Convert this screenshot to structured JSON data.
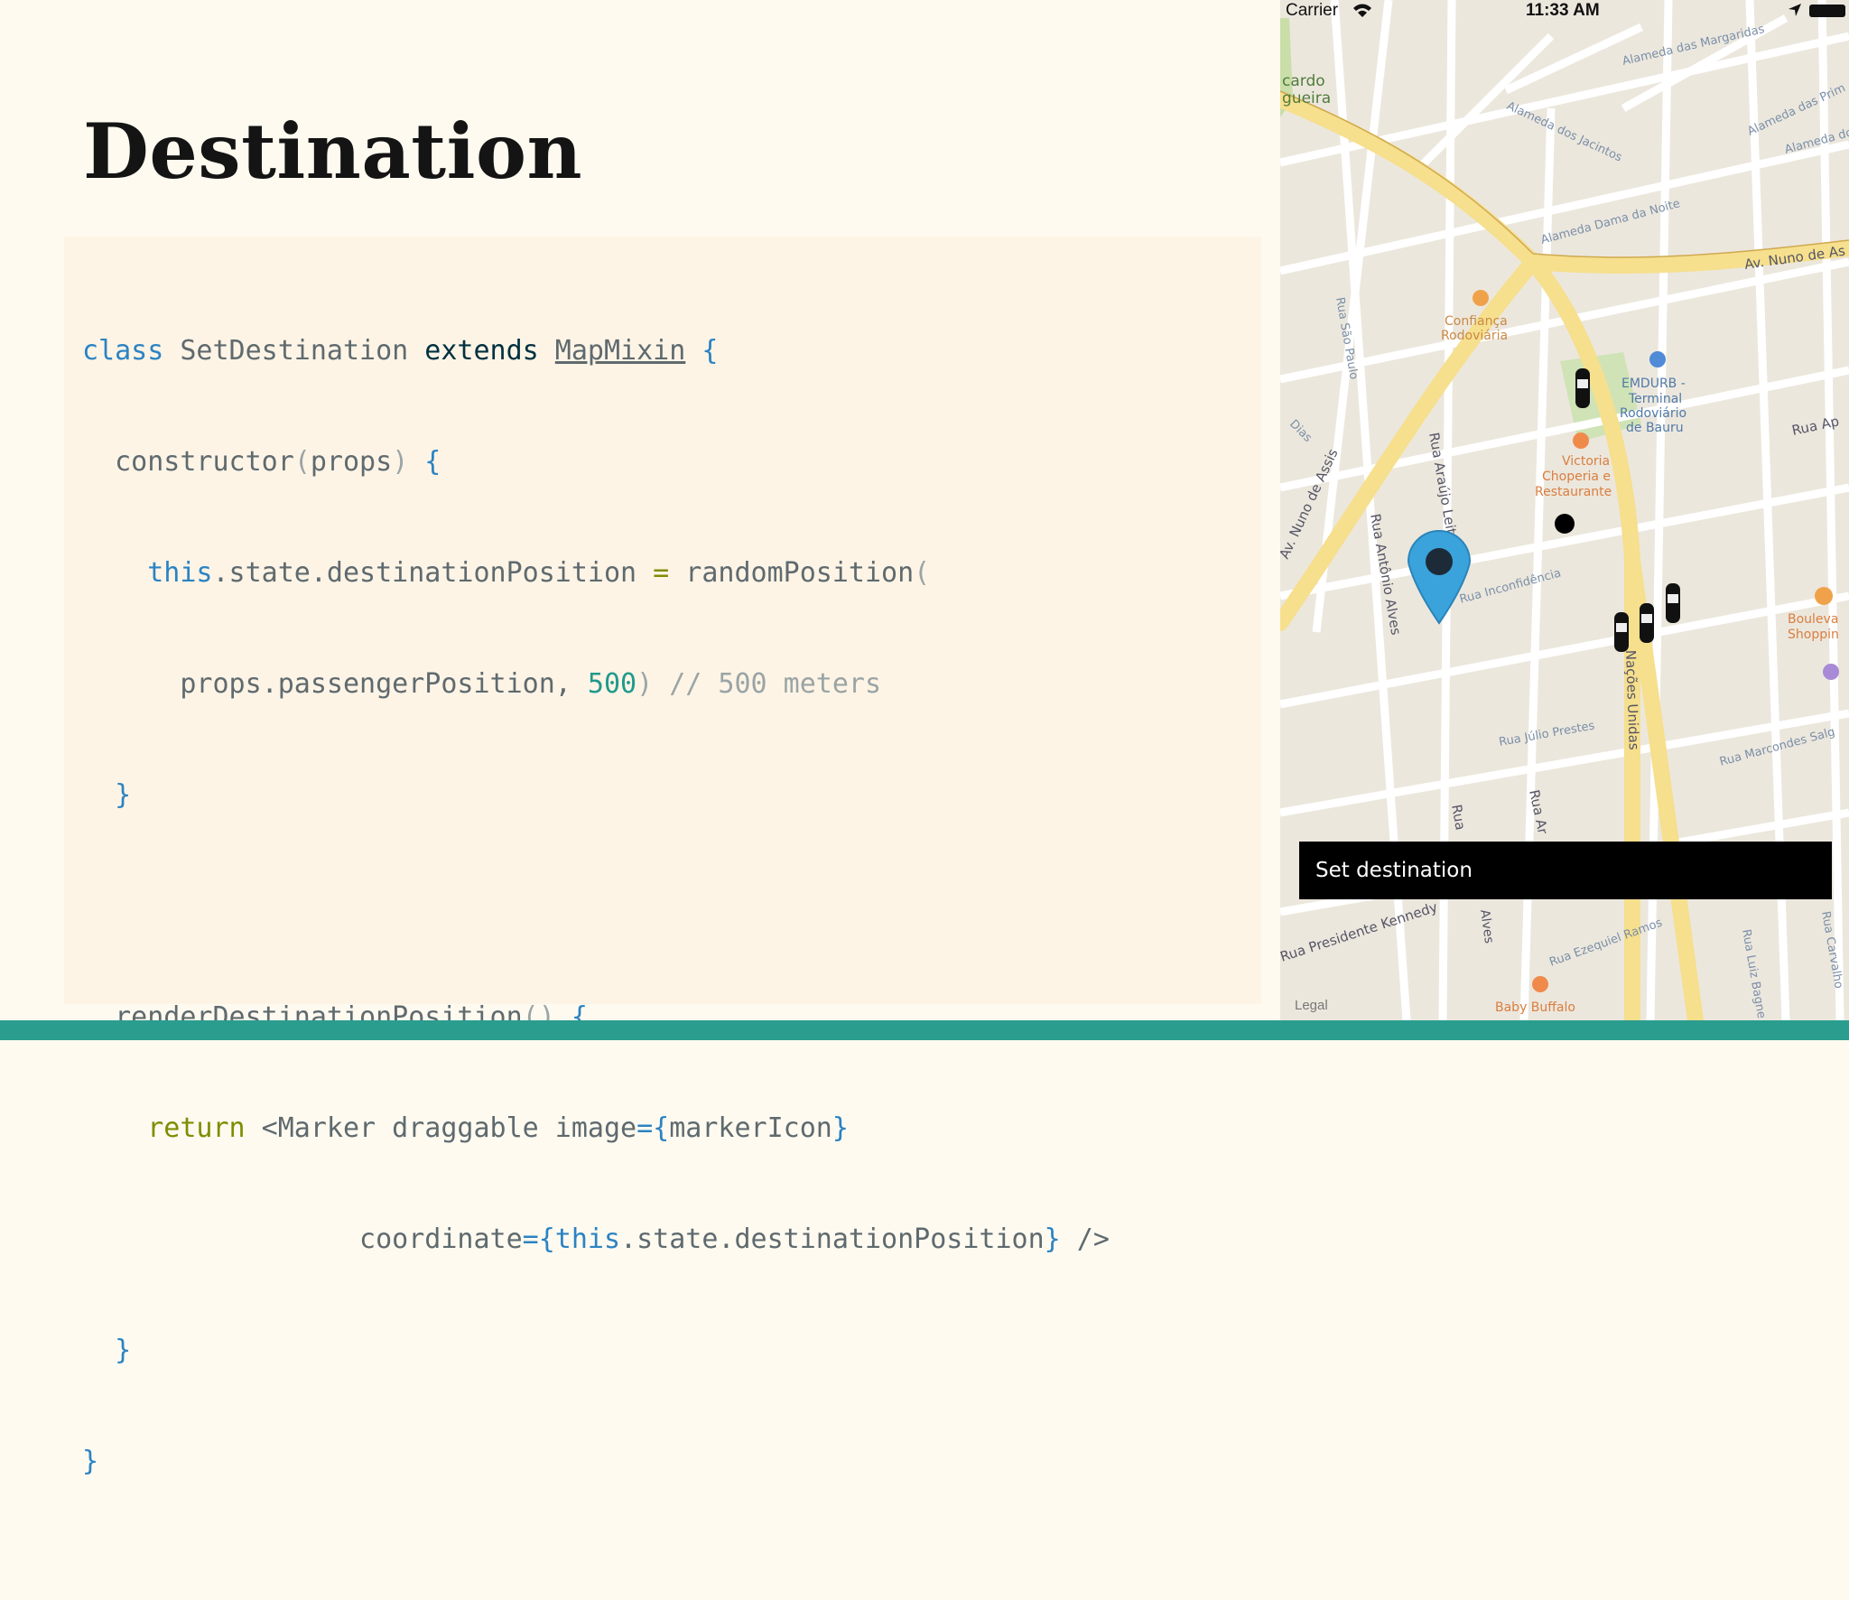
{
  "slide": {
    "title": "Destination",
    "code": {
      "l1": {
        "kw": "class",
        "name": " SetDestination ",
        "ext": "extends",
        "sp": " ",
        "base": "MapMixin",
        "brace": " {"
      },
      "l2": {
        "indent": "  ",
        "fn": "constructor",
        "p1": "(",
        "arg": "props",
        "p2": ")",
        "brace": " {"
      },
      "l3": {
        "indent": "    ",
        "this": "this",
        "rest": ".state.destinationPosition ",
        "op": "=",
        "call": " randomPosition",
        "paren": "("
      },
      "l4": {
        "indent": "      ",
        "arg": "props.passengerPosition, ",
        "num": "500",
        "paren": ")",
        "comment": " // 500 meters"
      },
      "l5": {
        "indent": "  ",
        "brace": "}"
      },
      "l7": {
        "indent": "  ",
        "fn": "renderDestinationPosition",
        "parens": "()",
        "brace": " {"
      },
      "l8": {
        "indent": "    ",
        "ret": "return",
        "tag": " <Marker draggable image",
        "eq": "={",
        "val": "markerIcon",
        "close": "}"
      },
      "l9": {
        "indent": "                 ",
        "attr": "coordinate",
        "eq": "={",
        "this": "this",
        "val": ".state.destinationPosition",
        "close": "}",
        "end": " />"
      },
      "l10": {
        "indent": "  ",
        "brace": "}"
      },
      "l11": {
        "brace": "}"
      }
    }
  },
  "phone": {
    "carrier": "Carrier",
    "time": "11:33 AM",
    "action_bar_label": "Set destination",
    "legal": "Legal",
    "map_labels": {
      "cardo": "cardo",
      "gueira": "gueira",
      "alameda_margaridas": "Alameda das Margaridas",
      "alameda_jacintos": "Alameda dos Jacintos",
      "alameda_prim": "Alameda das Prim",
      "alameda_do": "Alameda do",
      "alameda_dama": "Alameda Dama da Noite",
      "av_nuno": "Av. Nuno de As",
      "confianca": "Confiança",
      "rodoviaria": "Rodoviária",
      "emdurb1": "EMDURB -",
      "emdurb2": "Terminal",
      "emdurb3": "Rodoviário",
      "emdurb4": "de Bauru",
      "rua_ap": "Rua Ap",
      "rua_sao_paulo": "Rua São Paulo",
      "victoria1": "Victoria",
      "victoria2": "Choperia e",
      "victoria3": "Restaurante",
      "rua_araujo": "Rua Araújo Leit",
      "av_nuno_assis": "Av. Nuno de Assis",
      "rua_antonio": "Rua Antônio Alves",
      "rua_inconfidencia": "Rua Inconfidência",
      "boulevard1": "Bouleva",
      "boulevard2": "Shoppin",
      "nacoes": "Nações Unidas",
      "rua_julio": "Rua Júlio Prestes",
      "rua_marcondes": "Rua Marcondes Salg",
      "rua_short1": "Rua",
      "rua_short2": "Rua Ar",
      "rua_presidente": "Rua Presidente Kennedy",
      "alves": "Alves",
      "rua_ezequiel": "Rua Ezequiel Ramos",
      "baby_buffalo": "Baby Buffalo",
      "rua_luiz": "Rua Luiz Bagne",
      "rua_dias": "Dias",
      "rua_carv": "Rua Carvalho"
    }
  },
  "colors": {
    "background": "#fefaf0",
    "code_panel": "#fdf4e6",
    "footer": "#2a9d8f",
    "keyword_blue": "#2b83c2",
    "return_olive": "#7f8d00",
    "number_teal": "#209a8c",
    "pin_blue": "#3aa3dc"
  }
}
